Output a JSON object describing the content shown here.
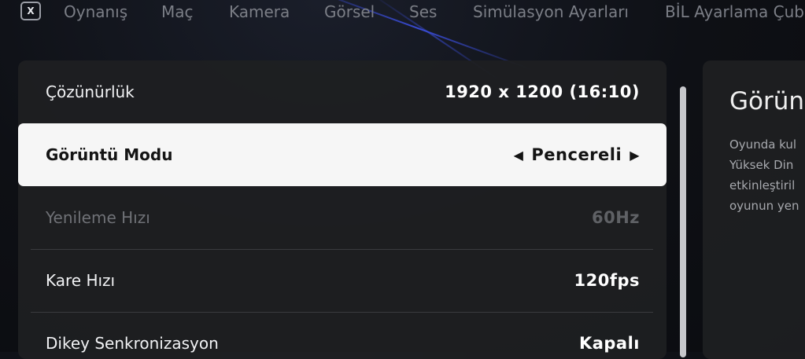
{
  "nav": {
    "close_key": "X",
    "tabs": [
      "Oynanış",
      "Maç",
      "Kamera",
      "Görsel",
      "Ses",
      "Simülasyon Ayarları",
      "BİL Ayarlama Çub"
    ]
  },
  "settings": [
    {
      "label": "Çözünürlük",
      "value": "1920 x 1200 (16:10)",
      "state": "normal"
    },
    {
      "label": "Görüntü Modu",
      "value": "Pencereli",
      "state": "selected"
    },
    {
      "label": "Yenileme Hızı",
      "value": "60Hz",
      "state": "disabled"
    },
    {
      "label": "Kare Hızı",
      "value": "120fps",
      "state": "normal"
    },
    {
      "label": "Dikey Senkronizasyon",
      "value": "Kapalı",
      "state": "normal"
    }
  ],
  "icons": {
    "left_arrow": "triangle-left-icon",
    "right_arrow": "triangle-right-icon"
  },
  "info": {
    "title": "Görün",
    "text": "Oyunda kul\nYüksek Din\netkinleştiril\noyunun yen"
  }
}
